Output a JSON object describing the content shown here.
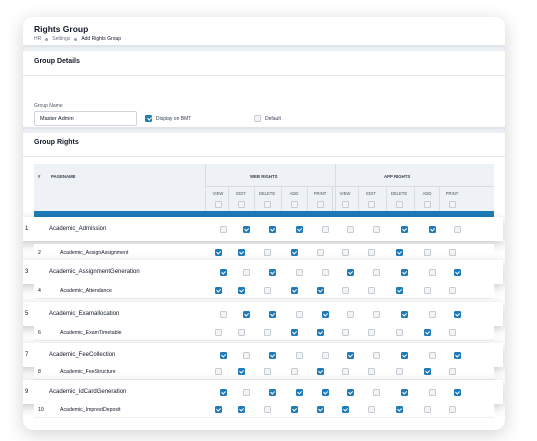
{
  "header": {
    "title": "Rights Group",
    "breadcrumbs": [
      "HR",
      "Settings",
      "Add Rights Group"
    ]
  },
  "group_details": {
    "section_title": "Group Details",
    "group_name_label": "Group Name",
    "group_name_value": "Master Admin",
    "display_on_bmt_label": "Display on BMT",
    "display_on_bmt_checked": true,
    "default_label": "Default",
    "default_checked": false
  },
  "group_rights": {
    "section_title": "Group Rights",
    "col_number": "#",
    "col_pagename": "PAGENAME",
    "web_rights_label": "WEB RIGHTS",
    "app_rights_label": "APP RIGHTS",
    "web_columns": [
      "VIEW",
      "EDIT",
      "DELETE",
      "ADD",
      "PRINT"
    ],
    "app_columns": [
      "VIEW",
      "EDIT",
      "DELETE",
      "ADD",
      "PRINT"
    ],
    "rows": [
      {
        "num": "1",
        "name": "Academic_Admission",
        "rights": [
          false,
          true,
          true,
          true,
          false,
          false,
          false,
          true,
          true,
          false
        ]
      },
      {
        "num": "2",
        "name": "Academic_AssignAssignment",
        "rights": [
          true,
          true,
          false,
          true,
          false,
          false,
          false,
          true,
          false,
          false
        ]
      },
      {
        "num": "3",
        "name": "Academic_AssignmentGeneration",
        "rights": [
          true,
          false,
          true,
          false,
          false,
          true,
          false,
          true,
          false,
          true
        ]
      },
      {
        "num": "4",
        "name": "Academic_Attendance",
        "rights": [
          true,
          true,
          false,
          true,
          true,
          false,
          false,
          true,
          false,
          false
        ]
      },
      {
        "num": "5",
        "name": "Academic_Examallocation",
        "rights": [
          false,
          true,
          true,
          false,
          true,
          false,
          false,
          true,
          false,
          true
        ]
      },
      {
        "num": "6",
        "name": "Academic_ExamTimetable",
        "rights": [
          false,
          false,
          false,
          true,
          true,
          false,
          false,
          false,
          true,
          false
        ]
      },
      {
        "num": "7",
        "name": "Academic_FeeCollection",
        "rights": [
          true,
          false,
          true,
          false,
          false,
          true,
          false,
          true,
          false,
          true
        ]
      },
      {
        "num": "8",
        "name": "Academic_FeeStructure",
        "rights": [
          false,
          true,
          false,
          false,
          true,
          false,
          false,
          false,
          true,
          false
        ]
      },
      {
        "num": "9",
        "name": "Academic_IdCardGeneration",
        "rights": [
          true,
          false,
          true,
          true,
          true,
          true,
          false,
          true,
          false,
          true
        ]
      },
      {
        "num": "10",
        "name": "Academic_ImprestDeposit",
        "rights": [
          true,
          true,
          false,
          true,
          true,
          true,
          false,
          true,
          false,
          false
        ]
      }
    ]
  }
}
